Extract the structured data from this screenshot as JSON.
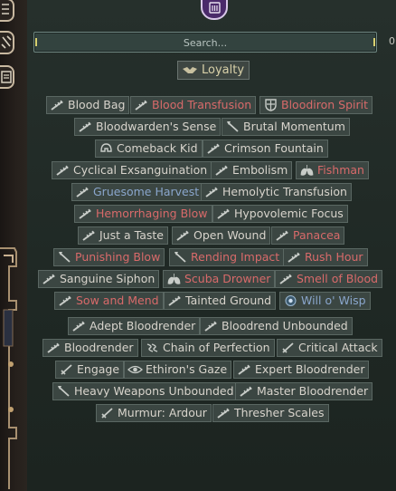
{
  "search": {
    "placeholder": "Search...",
    "count": "0"
  },
  "loyalty": {
    "label": "Loyalty"
  },
  "group1": [
    {
      "label": "Blood Bag",
      "color": "normal",
      "icon": "syringe-icon"
    },
    {
      "label": "Blood Transfusion",
      "color": "red",
      "icon": "syringe-icon"
    },
    {
      "label": "Bloodiron Spirit",
      "color": "red",
      "icon": "shield-icon"
    },
    {
      "label": "Bloodwarden's Sense",
      "color": "normal",
      "icon": "syringe-icon"
    },
    {
      "label": "Brutal Momentum",
      "color": "normal",
      "icon": "axe-icon"
    },
    {
      "label": "Comeback Kid",
      "color": "normal",
      "icon": "helmet-icon"
    },
    {
      "label": "Crimson Fountain",
      "color": "normal",
      "icon": "syringe-icon"
    },
    {
      "label": "Cyclical Exsanguination",
      "color": "normal",
      "icon": "syringe-icon"
    },
    {
      "label": "Embolism",
      "color": "normal",
      "icon": "syringe-icon"
    },
    {
      "label": "Fishman",
      "color": "red",
      "icon": "lungs-icon"
    },
    {
      "label": "Gruesome Harvest",
      "color": "blue",
      "icon": "syringe-icon"
    },
    {
      "label": "Hemolytic Transfusion",
      "color": "normal",
      "icon": "syringe-icon"
    },
    {
      "label": "Hemorrhaging Blow",
      "color": "red",
      "icon": "syringe-icon"
    },
    {
      "label": "Hypovolemic Focus",
      "color": "normal",
      "icon": "syringe-icon"
    },
    {
      "label": "Just a Taste",
      "color": "normal",
      "icon": "syringe-icon"
    },
    {
      "label": "Open Wound",
      "color": "normal",
      "icon": "syringe-icon"
    },
    {
      "label": "Panacea",
      "color": "red",
      "icon": "syringe-icon"
    },
    {
      "label": "Punishing Blow",
      "color": "red",
      "icon": "axe-icon"
    },
    {
      "label": "Rending Impact",
      "color": "red",
      "icon": "axe-icon"
    },
    {
      "label": "Rush Hour",
      "color": "red",
      "icon": "syringe-icon"
    },
    {
      "label": "Sanguine Siphon",
      "color": "normal",
      "icon": "syringe-icon"
    },
    {
      "label": "Scuba Drowner",
      "color": "red",
      "icon": "lungs-icon"
    },
    {
      "label": "Smell of Blood",
      "color": "red",
      "icon": "syringe-icon"
    },
    {
      "label": "Sow and Mend",
      "color": "red",
      "icon": "syringe-icon"
    },
    {
      "label": "Tainted Ground",
      "color": "normal",
      "icon": "syringe-icon"
    },
    {
      "label": "Will o' Wisp",
      "color": "blue",
      "icon": "wisp-icon"
    }
  ],
  "group2": [
    {
      "label": "Adept Bloodrender",
      "color": "normal",
      "icon": "syringe-icon"
    },
    {
      "label": "Bloodrend Unbounded",
      "color": "normal",
      "icon": "syringe-icon"
    },
    {
      "label": "Bloodrender",
      "color": "normal",
      "icon": "syringe-icon"
    },
    {
      "label": "Chain of Perfection",
      "color": "normal",
      "icon": "chain-icon"
    },
    {
      "label": "Critical Attack",
      "color": "normal",
      "icon": "sword-icon"
    },
    {
      "label": "Engage",
      "color": "normal",
      "icon": "sword-icon"
    },
    {
      "label": "Ethiron's Gaze",
      "color": "normal",
      "icon": "eye-icon"
    },
    {
      "label": "Expert Bloodrender",
      "color": "normal",
      "icon": "syringe-icon"
    },
    {
      "label": "Heavy Weapons Unbounded",
      "color": "normal",
      "icon": "axe-icon"
    },
    {
      "label": "Master Bloodrender",
      "color": "normal",
      "icon": "syringe-icon"
    },
    {
      "label": "Murmur: Ardour",
      "color": "normal",
      "icon": "sword-icon"
    },
    {
      "label": "Thresher Scales",
      "color": "normal",
      "icon": "syringe-icon"
    }
  ]
}
